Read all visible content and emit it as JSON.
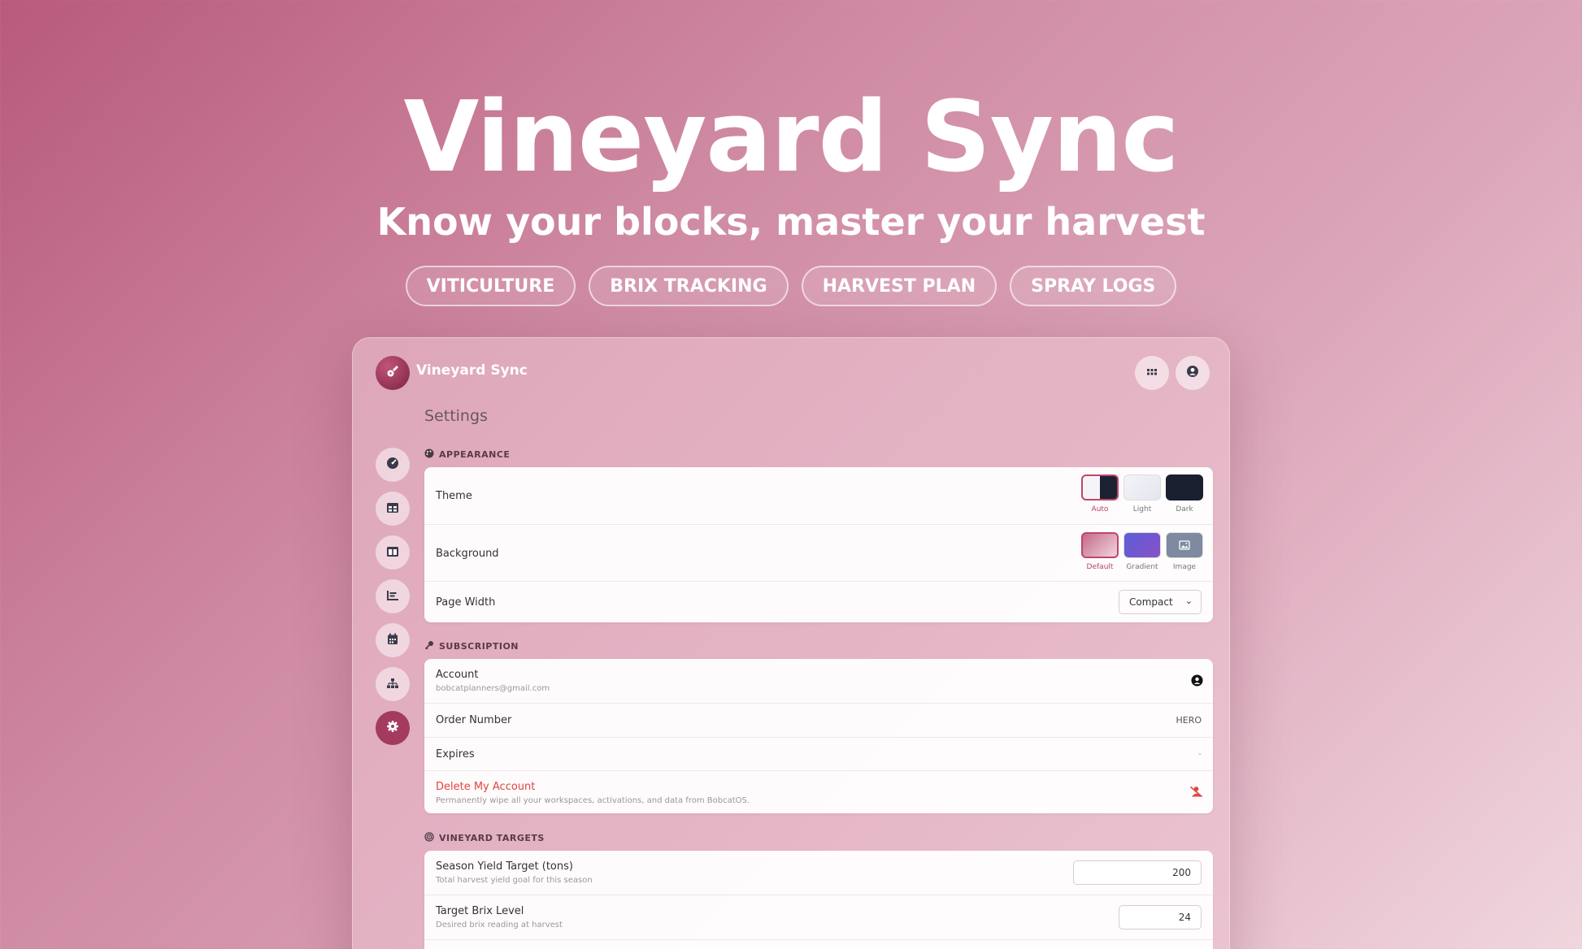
{
  "hero": {
    "title": "Vineyard Sync",
    "subtitle": "Know your blocks, master your harvest",
    "tags": [
      "VITICULTURE",
      "BRIX TRACKING",
      "HARVEST PLAN",
      "SPRAY LOGS"
    ]
  },
  "app": {
    "name": "Vineyard Sync",
    "page_title": "Settings",
    "logo_icon": "guitar-icon",
    "top_buttons": [
      "grid-icon",
      "user-icon"
    ],
    "accent": "#a33a5f"
  },
  "sidebar": {
    "items": [
      {
        "icon": "palette-icon",
        "active": false
      },
      {
        "icon": "table-icon",
        "active": false
      },
      {
        "icon": "columns-icon",
        "active": false
      },
      {
        "icon": "chart-icon",
        "active": false
      },
      {
        "icon": "calendar-icon",
        "active": false
      },
      {
        "icon": "hierarchy-icon",
        "active": false
      },
      {
        "icon": "gear-icon",
        "active": true
      }
    ]
  },
  "appearance": {
    "heading": "APPEARANCE",
    "theme_label": "Theme",
    "theme_options": [
      {
        "label": "Auto",
        "selected": true
      },
      {
        "label": "Light",
        "selected": false
      },
      {
        "label": "Dark",
        "selected": false
      }
    ],
    "background_label": "Background",
    "background_options": [
      {
        "label": "Default",
        "selected": true
      },
      {
        "label": "Gradient",
        "selected": false
      },
      {
        "label": "Image",
        "selected": false
      }
    ],
    "page_width_label": "Page Width",
    "page_width_value": "Compact"
  },
  "subscription": {
    "heading": "SUBSCRIPTION",
    "account_label": "Account",
    "account_email": "bobcatplanners@gmail.com",
    "order_label": "Order Number",
    "order_value": "HERO",
    "expires_label": "Expires",
    "expires_value": "-",
    "delete_label": "Delete My Account",
    "delete_desc": "Permanently wipe all your workspaces, activations, and data from BobcatOS.",
    "delete_color": "#e0453f"
  },
  "targets": {
    "heading": "VINEYARD TARGETS",
    "yield_label": "Season Yield Target (tons)",
    "yield_desc": "Total harvest yield goal for this season",
    "yield_value": "200",
    "brix_label": "Target Brix Level",
    "brix_desc": "Desired brix reading at harvest",
    "brix_value": "24"
  }
}
